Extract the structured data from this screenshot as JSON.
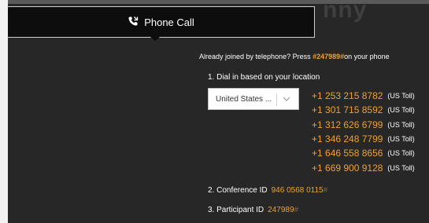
{
  "header": {
    "background_title": "nny",
    "tab_label": "Phone Call",
    "tab_icon": "phone-call-icon"
  },
  "joined": {
    "prefix": "Already joined by telephone? Press ",
    "pin": "#247989#",
    "suffix": "on your phone"
  },
  "dial_in": {
    "label": "1. Dial in based on your location",
    "country_value": "United States ...",
    "numbers": [
      {
        "number": "+1 253 215 8782",
        "tag": "(US Toll)"
      },
      {
        "number": "+1 301 715 8592",
        "tag": "(US Toll)"
      },
      {
        "number": "+1 312 626 6799",
        "tag": "(US Toll)"
      },
      {
        "number": "+1 346 248 7799",
        "tag": "(US Toll)"
      },
      {
        "number": "+1 646 558 8656",
        "tag": "(US Toll)"
      },
      {
        "number": "+1 669 900 9128",
        "tag": "(US Toll)"
      }
    ]
  },
  "conference": {
    "label": "2. Conference ID",
    "value": "946 0568 0115",
    "suffix": "#"
  },
  "participant": {
    "label": "3. Participant ID",
    "value": "247989",
    "suffix": "#"
  },
  "colors": {
    "accent": "#f0a030",
    "background": "#272727",
    "tab_background": "#0d0d0d"
  }
}
